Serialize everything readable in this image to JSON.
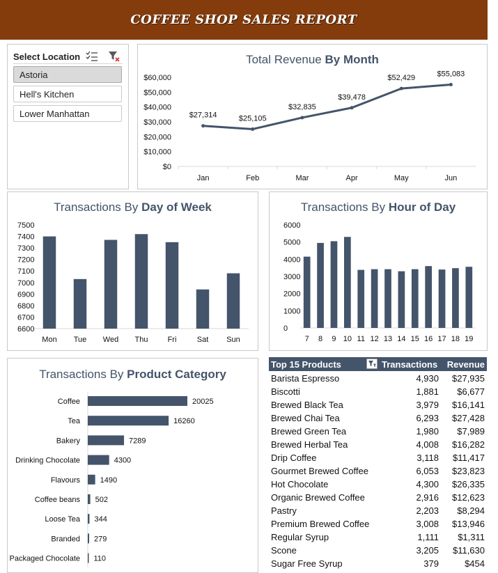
{
  "header": {
    "title": "COFFEE SHOP SALES REPORT"
  },
  "slicer": {
    "title": "Select Location",
    "multi_select_icon": "multi-select-icon",
    "clear_filter_icon": "clear-filter-icon",
    "items": [
      {
        "label": "Astoria",
        "selected": true
      },
      {
        "label": "Hell's Kitchen",
        "selected": false
      },
      {
        "label": "Lower Manhattan",
        "selected": false
      }
    ]
  },
  "charts": {
    "revenue": {
      "title_plain": "Total Revenue ",
      "title_bold": "By Month"
    },
    "dow": {
      "title_plain": "Transactions By ",
      "title_bold": "Day of Week"
    },
    "hour": {
      "title_plain": "Transactions By ",
      "title_bold": "Hour of Day"
    },
    "category": {
      "title_plain": "Transactions By ",
      "title_bold": "Product Category"
    }
  },
  "chart_data": [
    {
      "id": "revenue",
      "type": "line",
      "title": "Total Revenue By Month",
      "categories": [
        "Jan",
        "Feb",
        "Mar",
        "Apr",
        "May",
        "Jun"
      ],
      "values": [
        27314,
        25105,
        32835,
        39478,
        52429,
        55083
      ],
      "data_labels": [
        "$27,314",
        "$25,105",
        "$32,835",
        "$39,478",
        "$52,429",
        "$55,083"
      ],
      "yticks": [
        "$0",
        "$10,000",
        "$20,000",
        "$30,000",
        "$40,000",
        "$50,000",
        "$60,000"
      ],
      "ylim": [
        0,
        60000
      ],
      "color": "#44546a",
      "grid": false
    },
    {
      "id": "dow",
      "type": "bar",
      "title": "Transactions By Day of Week",
      "categories": [
        "Mon",
        "Tue",
        "Wed",
        "Thu",
        "Fri",
        "Sat",
        "Sun"
      ],
      "values": [
        7400,
        7030,
        7370,
        7420,
        7350,
        6940,
        7080
      ],
      "yticks": [
        "6600",
        "6700",
        "6800",
        "6900",
        "7000",
        "7100",
        "7200",
        "7300",
        "7400",
        "7500"
      ],
      "ylim": [
        6600,
        7500
      ],
      "color": "#44546a"
    },
    {
      "id": "hour",
      "type": "bar",
      "title": "Transactions By Hour of Day",
      "categories": [
        "7",
        "8",
        "9",
        "10",
        "11",
        "12",
        "13",
        "14",
        "15",
        "16",
        "17",
        "18",
        "19"
      ],
      "values": [
        4150,
        4950,
        5050,
        5300,
        3380,
        3420,
        3420,
        3300,
        3420,
        3600,
        3400,
        3480,
        3560
      ],
      "yticks": [
        "0",
        "1000",
        "2000",
        "3000",
        "4000",
        "5000",
        "6000"
      ],
      "ylim": [
        0,
        6000
      ],
      "color": "#44546a"
    },
    {
      "id": "category",
      "type": "bar",
      "orientation": "horizontal",
      "title": "Transactions By Product Category",
      "categories": [
        "Coffee",
        "Tea",
        "Bakery",
        "Drinking Chocolate",
        "Flavours",
        "Coffee beans",
        "Loose Tea",
        "Branded",
        "Packaged Chocolate"
      ],
      "values": [
        20025,
        16260,
        7289,
        4300,
        1490,
        502,
        344,
        279,
        110
      ],
      "data_labels": [
        "20025",
        "16260",
        "7289",
        "4300",
        "1490",
        "502",
        "344",
        "279",
        "110"
      ],
      "color": "#44546a"
    }
  ],
  "top_products": {
    "headers": {
      "product": "Top 15 Products",
      "transactions": "Transactions",
      "revenue": "Revenue"
    },
    "filter_icon": "filter-icon",
    "rows": [
      {
        "product": "Barista Espresso",
        "transactions": "4,930",
        "revenue": "$27,935"
      },
      {
        "product": "Biscotti",
        "transactions": "1,881",
        "revenue": "$6,677"
      },
      {
        "product": "Brewed Black Tea",
        "transactions": "3,979",
        "revenue": "$16,141"
      },
      {
        "product": "Brewed Chai Tea",
        "transactions": "6,293",
        "revenue": "$27,428"
      },
      {
        "product": "Brewed Green Tea",
        "transactions": "1,980",
        "revenue": "$7,989"
      },
      {
        "product": "Brewed Herbal Tea",
        "transactions": "4,008",
        "revenue": "$16,282"
      },
      {
        "product": "Drip Coffee",
        "transactions": "3,118",
        "revenue": "$11,417"
      },
      {
        "product": "Gourmet Brewed Coffee",
        "transactions": "6,053",
        "revenue": "$23,823"
      },
      {
        "product": "Hot Chocolate",
        "transactions": "4,300",
        "revenue": "$26,335"
      },
      {
        "product": "Organic Brewed Coffee",
        "transactions": "2,916",
        "revenue": "$12,623"
      },
      {
        "product": "Pastry",
        "transactions": "2,203",
        "revenue": "$8,294"
      },
      {
        "product": "Premium Brewed Coffee",
        "transactions": "3,008",
        "revenue": "$13,946"
      },
      {
        "product": "Regular Syrup",
        "transactions": "1,111",
        "revenue": "$1,311"
      },
      {
        "product": "Scone",
        "transactions": "3,205",
        "revenue": "$11,630"
      },
      {
        "product": "Sugar Free Syrup",
        "transactions": "379",
        "revenue": "$454"
      }
    ]
  }
}
